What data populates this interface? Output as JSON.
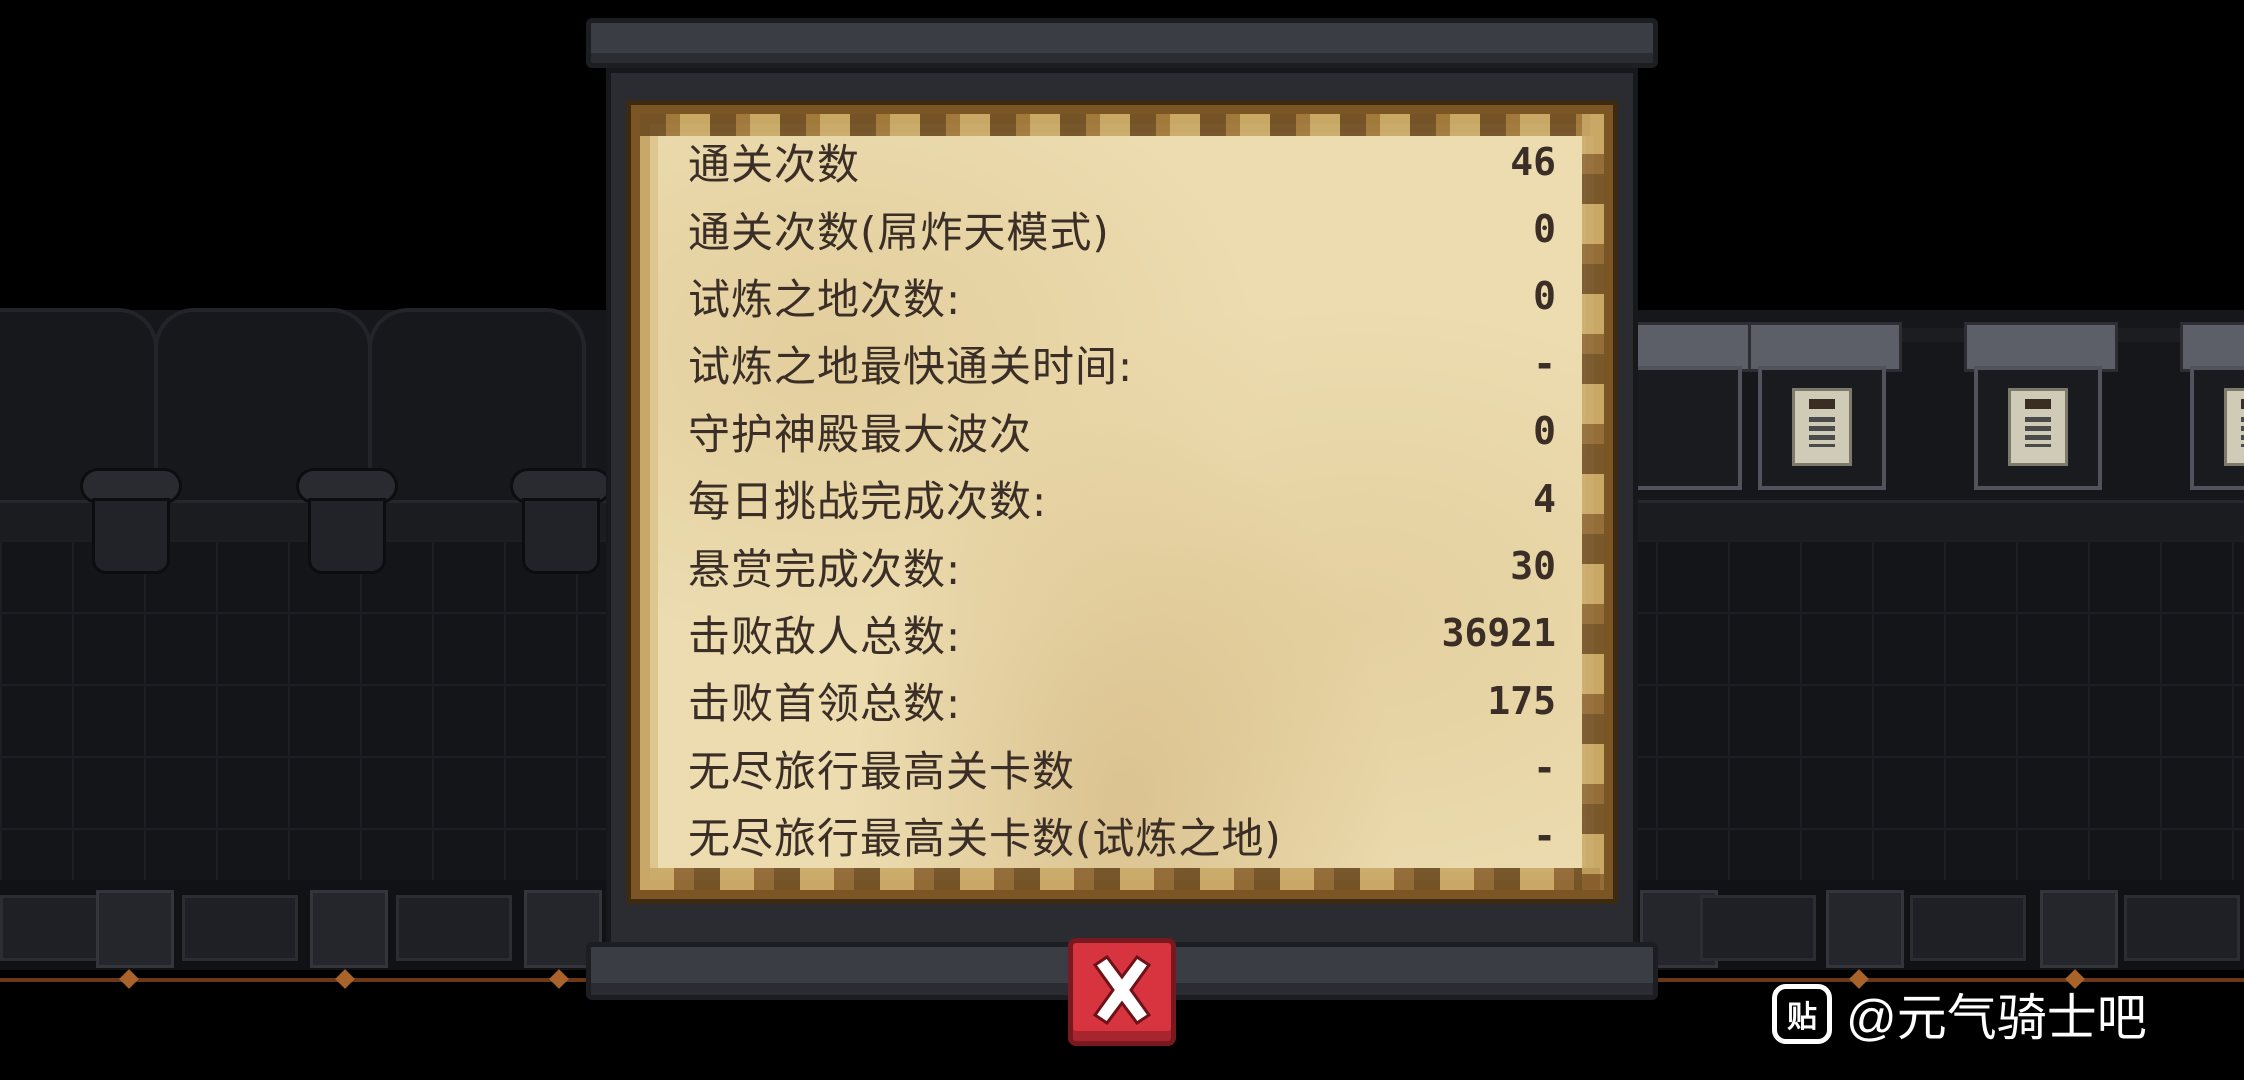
{
  "stats": [
    {
      "label": "通关次数",
      "value": "46"
    },
    {
      "label": "通关次数(屌炸天模式)",
      "value": "0"
    },
    {
      "label": "试炼之地次数:",
      "value": "0"
    },
    {
      "label": "试炼之地最快通关时间:",
      "value": "-"
    },
    {
      "label": "守护神殿最大波次",
      "value": "0"
    },
    {
      "label": "每日挑战完成次数:",
      "value": "4"
    },
    {
      "label": "悬赏完成次数:",
      "value": "30"
    },
    {
      "label": "击败敌人总数:",
      "value": "36921"
    },
    {
      "label": "击败首领总数:",
      "value": "175"
    },
    {
      "label": "无尽旅行最高关卡数",
      "value": "-"
    },
    {
      "label": "无尽旅行最高关卡数(试炼之地)",
      "value": "-"
    }
  ],
  "close_button": {
    "icon": "close-icon",
    "color": "#d7343f"
  },
  "watermark": {
    "icon_text": "贴",
    "text": "@元气骑士吧"
  }
}
